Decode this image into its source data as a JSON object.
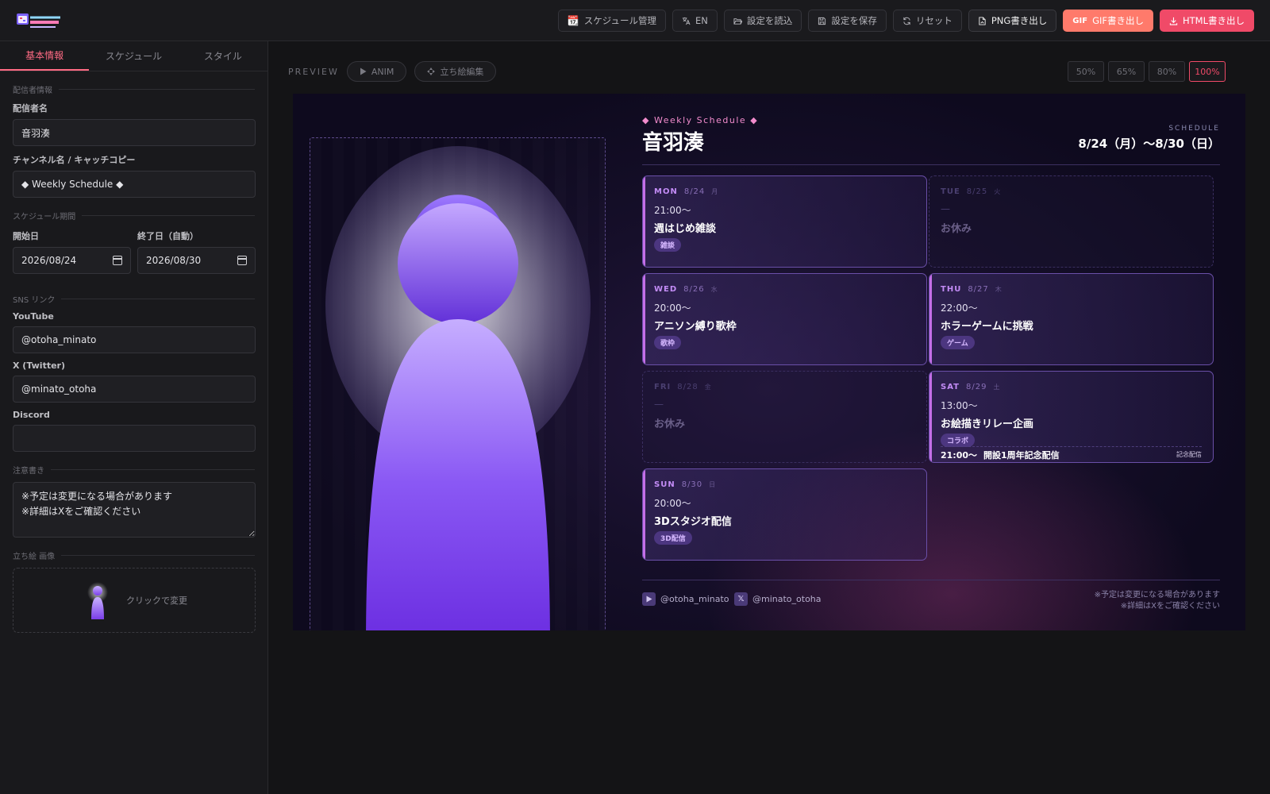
{
  "toolbar": {
    "schedule_manage": "スケジュール管理",
    "lang": "EN",
    "load": "設定を読込",
    "save": "設定を保存",
    "reset": "リセット",
    "png_export": "PNG書き出し",
    "gif_badge": "GIF",
    "gif_export": "GIF書き出し",
    "html_export": "HTML書き出し"
  },
  "sidebar": {
    "tabs": [
      "基本情報",
      "スケジュール",
      "スタイル"
    ],
    "sections": {
      "streamer": "配信者情報",
      "period": "スケジュール期間",
      "sns": "SNS リンク",
      "notes": "注意書き",
      "image": "立ち絵 画像"
    },
    "fields": {
      "name_label": "配信者名",
      "name_value": "音羽湊",
      "catch_label": "チャンネル名 / キャッチコピー",
      "catch_value": "◆ Weekly Schedule ◆",
      "start_label": "開始日",
      "start_value": "2026/08/24",
      "end_label": "終了日（自動）",
      "end_value": "2026/08/30",
      "youtube_label": "YouTube",
      "youtube_value": "@otoha_minato",
      "x_label": "X (Twitter)",
      "x_value": "@minato_otoha",
      "discord_label": "Discord",
      "discord_value": "",
      "notes_value": "※予定は変更になる場合があります\n※詳細はXをご確認ください",
      "image_hint": "クリックで変更"
    }
  },
  "preview": {
    "label": "PREVIEW",
    "anim": "ANIM",
    "edit": "立ち絵編集",
    "zoom": [
      "50%",
      "65%",
      "80%",
      "100%"
    ],
    "zoom_active": "100%"
  },
  "schedule": {
    "catch": "◆ Weekly Schedule ◆",
    "name": "音羽湊",
    "label": "SCHEDULE",
    "range": "8/24（月）〜8/30（日）",
    "days": [
      {
        "day": "MON",
        "date": "8/24",
        "jp": "月",
        "time": "21:00〜",
        "title": "週はじめ雑談",
        "tag": "雑談",
        "off": false
      },
      {
        "day": "TUE",
        "date": "8/25",
        "jp": "火",
        "time": "—",
        "title": "お休み",
        "tag": "",
        "off": true
      },
      {
        "day": "WED",
        "date": "8/26",
        "jp": "水",
        "time": "20:00〜",
        "title": "アニソン縛り歌枠",
        "tag": "歌枠",
        "off": false
      },
      {
        "day": "THU",
        "date": "8/27",
        "jp": "木",
        "time": "22:00〜",
        "title": "ホラーゲームに挑戦",
        "tag": "ゲーム",
        "off": false
      },
      {
        "day": "FRI",
        "date": "8/28",
        "jp": "金",
        "time": "—",
        "title": "お休み",
        "tag": "",
        "off": true
      },
      {
        "day": "SAT",
        "date": "8/29",
        "jp": "土",
        "time": "13:00〜",
        "title": "お絵描きリレー企画",
        "tag": "コラボ",
        "off": false,
        "extra": {
          "time": "21:00〜",
          "title": "開設1周年記念配信",
          "tag": "記念配信"
        }
      },
      {
        "day": "SUN",
        "date": "8/30",
        "jp": "日",
        "time": "20:00〜",
        "title": "3Dスタジオ配信",
        "tag": "3D配信",
        "off": false
      }
    ],
    "footer": {
      "youtube": "@otoha_minato",
      "x": "@minato_otoha",
      "notes": [
        "※予定は変更になる場合があります",
        "※詳細はXをご確認ください"
      ]
    }
  },
  "colors": {
    "accent": "#f04a68",
    "gif": "#ff7a6b",
    "card_border": "#6a4fa8",
    "card_bar": "#c46fe8",
    "day_label": "#c38cf6"
  }
}
